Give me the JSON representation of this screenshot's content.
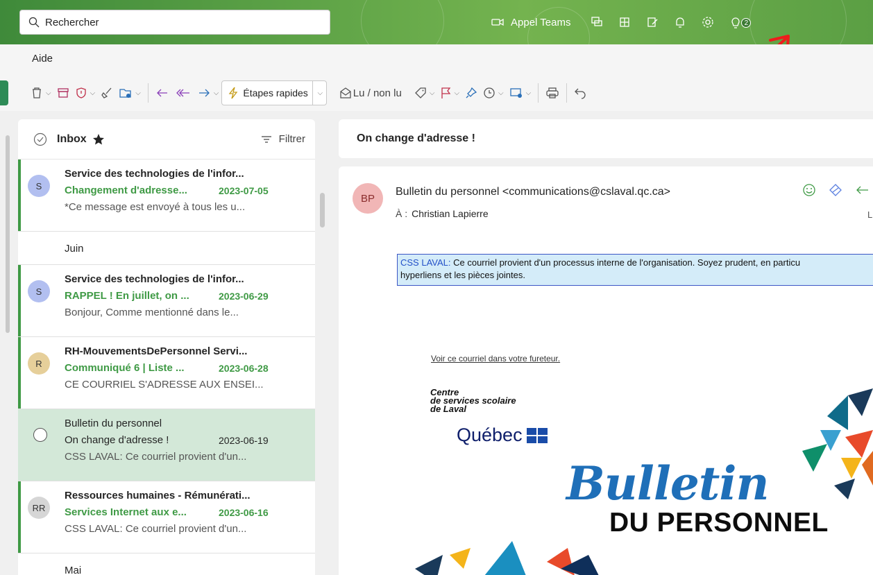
{
  "header": {
    "search_placeholder": "Rechercher",
    "teams_call_label": "Appel Teams",
    "tips_badge": "2"
  },
  "menu": {
    "help": "Aide"
  },
  "toolbar": {
    "quick_steps": "Étapes rapides",
    "read_unread": "Lu / non lu"
  },
  "list": {
    "folder_title": "Inbox",
    "filter_label": "Filtrer",
    "items": [
      {
        "initials": "S",
        "avatar_color": "#b2bff0",
        "from": "Service des technologies de l'infor...",
        "subject": "Changement d'adresse...",
        "date": "2023-07-05",
        "preview": "*Ce message est envoyé à tous les u..."
      },
      {
        "initials": "S",
        "avatar_color": "#b2bff0",
        "from": "Service des technologies de l'infor...",
        "subject": "RAPPEL ! En juillet, on ...",
        "date": "2023-06-29",
        "preview": "Bonjour, Comme mentionné dans le..."
      },
      {
        "initials": "R",
        "avatar_color": "#e6cf9a",
        "from": "RH-MouvementsDePersonnel Servi...",
        "subject": "Communiqué 6 | Liste ...",
        "date": "2023-06-28",
        "preview": "CE COURRIEL S'ADRESSE AUX ENSEI..."
      },
      {
        "initials": "",
        "avatar_color": "",
        "from": "Bulletin du personnel",
        "subject": "On change d'adresse !",
        "date": "2023-06-19",
        "preview": "CSS LAVAL: Ce courriel provient d'un..."
      },
      {
        "initials": "RR",
        "avatar_color": "#d6d6d6",
        "from": "Ressources humaines - Rémunérati...",
        "subject": "Services Internet aux e...",
        "date": "2023-06-16",
        "preview": "CSS LAVAL: Ce courriel provient d'un..."
      }
    ],
    "groups": {
      "june": "Juin",
      "may": "Mai"
    }
  },
  "reading": {
    "subject": "On change d'adresse !",
    "sender_initials": "BP",
    "sender": "Bulletin du personnel <communications@cslaval.qc.ca>",
    "to_label": "À :",
    "to": "Christian Lapierre",
    "cut_right_letter": "L",
    "banner_label": "CSS LAVAL:",
    "banner_text": " Ce courriel provient d'un processus interne de l'organisation. Soyez prudent, en particu",
    "banner_text2": "hyperliens et les pièces jointes.",
    "view_in_browser": "Voir ce courriel dans votre fureteur.",
    "logo_line1": "Centre",
    "logo_line2": "de services scolaire",
    "logo_line3": "de Laval",
    "logo_quebec": "Québec",
    "bulletin_word": "Bulletin",
    "personnel_word": "DU PERSONNEL"
  },
  "colors": {
    "accent": "#3f9a45",
    "header_green": "#5ea347",
    "selected_bg": "#d3e8d8",
    "annotation_arrow": "#ee1c1c"
  }
}
